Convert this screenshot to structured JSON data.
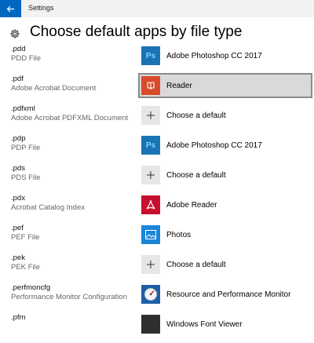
{
  "window": {
    "title": "Settings"
  },
  "page": {
    "title": "Choose default apps by file type"
  },
  "rows": [
    {
      "ext": ".pdd",
      "desc": "PDD File",
      "app": "Adobe Photoshop CC 2017",
      "icon": "photoshop-icon",
      "selected": false
    },
    {
      "ext": ".pdf",
      "desc": "Adobe Acrobat Document",
      "app": "Reader",
      "icon": "reader-icon",
      "selected": true
    },
    {
      "ext": ".pdfxml",
      "desc": "Adobe Acrobat PDFXML Document",
      "app": "Choose a default",
      "icon": "plus-icon",
      "selected": false
    },
    {
      "ext": ".pdp",
      "desc": "PDP File",
      "app": "Adobe Photoshop CC 2017",
      "icon": "photoshop-icon",
      "selected": false
    },
    {
      "ext": ".pds",
      "desc": "PDS File",
      "app": "Choose a default",
      "icon": "plus-icon",
      "selected": false
    },
    {
      "ext": ".pdx",
      "desc": "Acrobat Catalog Index",
      "app": "Adobe Reader",
      "icon": "adobe-reader-icon",
      "selected": false
    },
    {
      "ext": ".pef",
      "desc": "PEF File",
      "app": "Photos",
      "icon": "photos-icon",
      "selected": false
    },
    {
      "ext": ".pek",
      "desc": "PEK File",
      "app": "Choose a default",
      "icon": "plus-icon",
      "selected": false
    },
    {
      "ext": ".perfmoncfg",
      "desc": "Performance Monitor Configuration",
      "app": "Resource and Performance Monitor",
      "icon": "performance-monitor-icon",
      "selected": false
    },
    {
      "ext": ".pfm",
      "desc": "",
      "app": "Windows Font Viewer",
      "icon": "font-viewer-icon",
      "selected": false
    }
  ],
  "colors": {
    "accent": "#0067c0",
    "selected_bg": "#d9d9d9",
    "photoshop": "#1a74b4",
    "reader": "#d84a2b"
  }
}
